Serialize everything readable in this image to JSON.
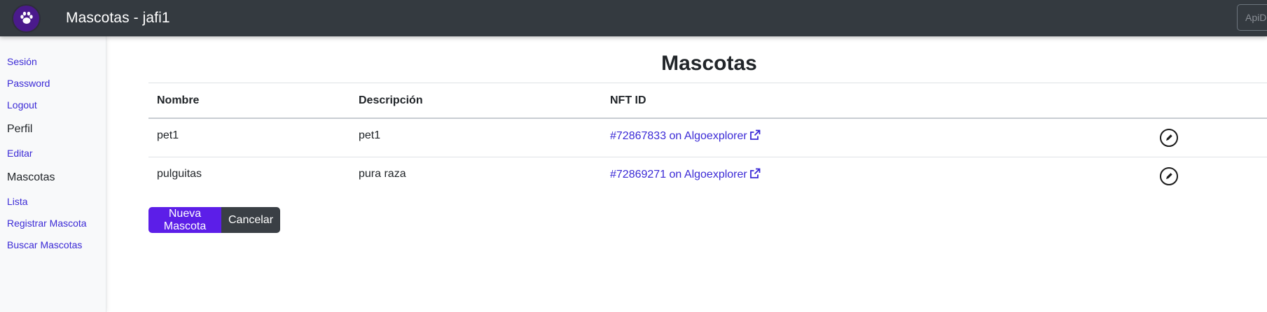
{
  "header": {
    "title": "Mascotas - jafi1",
    "logo_icon": "paw-icon",
    "input_placeholder": "ApiDoc"
  },
  "sidebar": {
    "session_links": [
      {
        "label": "Sesión"
      },
      {
        "label": "Password"
      },
      {
        "label": "Logout"
      }
    ],
    "profile_heading": "Perfil",
    "profile_links": [
      {
        "label": "Editar"
      }
    ],
    "pets_heading": "Mascotas",
    "pets_links": [
      {
        "label": "Lista"
      },
      {
        "label": "Registrar Mascota"
      },
      {
        "label": "Buscar Mascotas"
      }
    ]
  },
  "main": {
    "title": "Mascotas",
    "table": {
      "headers": [
        "Nombre",
        "Descripción",
        "NFT ID"
      ],
      "rows": [
        {
          "name": "pet1",
          "description": "pet1",
          "nft_link": "#72867833 on Algoexplorer"
        },
        {
          "name": "pulguitas",
          "description": "pura raza",
          "nft_link": "#72869271 on Algoexplorer"
        }
      ]
    },
    "buttons": {
      "new_label": "Nueva Mascota",
      "cancel_label": "Cancelar"
    }
  },
  "colors": {
    "navbar": "#343a40",
    "link": "#3b2ad6",
    "primary_button": "#5c1ee8",
    "secondary_button": "#3a3f45"
  }
}
